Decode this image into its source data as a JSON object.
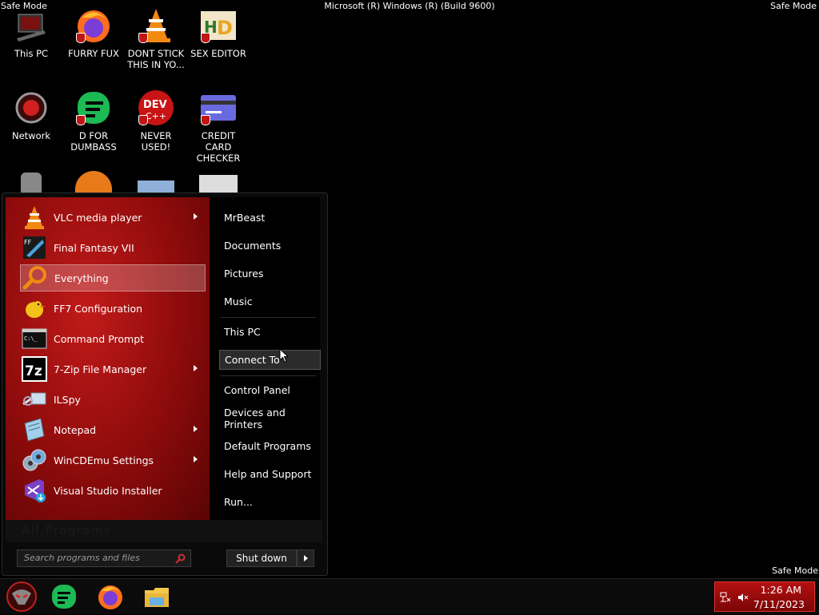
{
  "watermarks": {
    "top_left": "Safe Mode",
    "top_right": "Safe Mode",
    "bottom_right": "Safe Mode",
    "center": "Microsoft (R) Windows (R) (Build 9600)"
  },
  "desktop_icons": [
    {
      "label": "This PC",
      "icon": "computer-icon"
    },
    {
      "label": "FURRY FUX",
      "icon": "firefox-icon"
    },
    {
      "label": "DONT STICK THIS IN YO...",
      "icon": "vlc-cone-icon"
    },
    {
      "label": "SEX EDITOR",
      "icon": "hxd-icon"
    },
    {
      "label": "Network",
      "icon": "network-icon"
    },
    {
      "label": "D FOR DUMBASS",
      "icon": "discord-icon"
    },
    {
      "label": "NEVER USED!",
      "icon": "devcpp-icon"
    },
    {
      "label": "CREDIT CARD CHECKER",
      "icon": "credit-card-icon"
    }
  ],
  "start_menu": {
    "programs": [
      {
        "label": "VLC media player",
        "icon": "vlc-icon",
        "has_submenu": true
      },
      {
        "label": "Final Fantasy VII",
        "icon": "ff7-icon",
        "has_submenu": false
      },
      {
        "label": "Everything",
        "icon": "everything-search-icon",
        "has_submenu": false,
        "selected": true
      },
      {
        "label": "FF7 Configuration",
        "icon": "chocobo-icon",
        "has_submenu": false
      },
      {
        "label": "Command Prompt",
        "icon": "cmd-icon",
        "has_submenu": false
      },
      {
        "label": "7-Zip File Manager",
        "icon": "7zip-icon",
        "has_submenu": true
      },
      {
        "label": "ILSpy",
        "icon": "ilspy-icon",
        "has_submenu": false
      },
      {
        "label": "Notepad",
        "icon": "notepad-icon",
        "has_submenu": true
      },
      {
        "label": "WinCDEmu Settings",
        "icon": "wincdemu-icon",
        "has_submenu": true
      },
      {
        "label": "Visual Studio Installer",
        "icon": "vs-installer-icon",
        "has_submenu": false
      }
    ],
    "places": [
      {
        "label": "MrBeast"
      },
      {
        "label": "Documents"
      },
      {
        "label": "Pictures"
      },
      {
        "label": "Music"
      },
      {
        "label": "This PC"
      },
      {
        "label": "Connect To",
        "hovered": true
      },
      {
        "label": "Control Panel"
      },
      {
        "label": "Devices and Printers"
      },
      {
        "label": "Default Programs"
      },
      {
        "label": "Help and Support"
      },
      {
        "label": "Run..."
      }
    ],
    "all_programs": "All Programs",
    "search_placeholder": "Search programs and files",
    "shutdown_label": "Shut down"
  },
  "taskbar": {
    "pinned": [
      "start-orb-icon",
      "discord-icon",
      "firefox-icon",
      "file-explorer-icon"
    ],
    "clock_time": "1:26 AM",
    "clock_date": "7/11/2023"
  },
  "colors": {
    "accent_red": "#b51010",
    "background": "#000000"
  }
}
